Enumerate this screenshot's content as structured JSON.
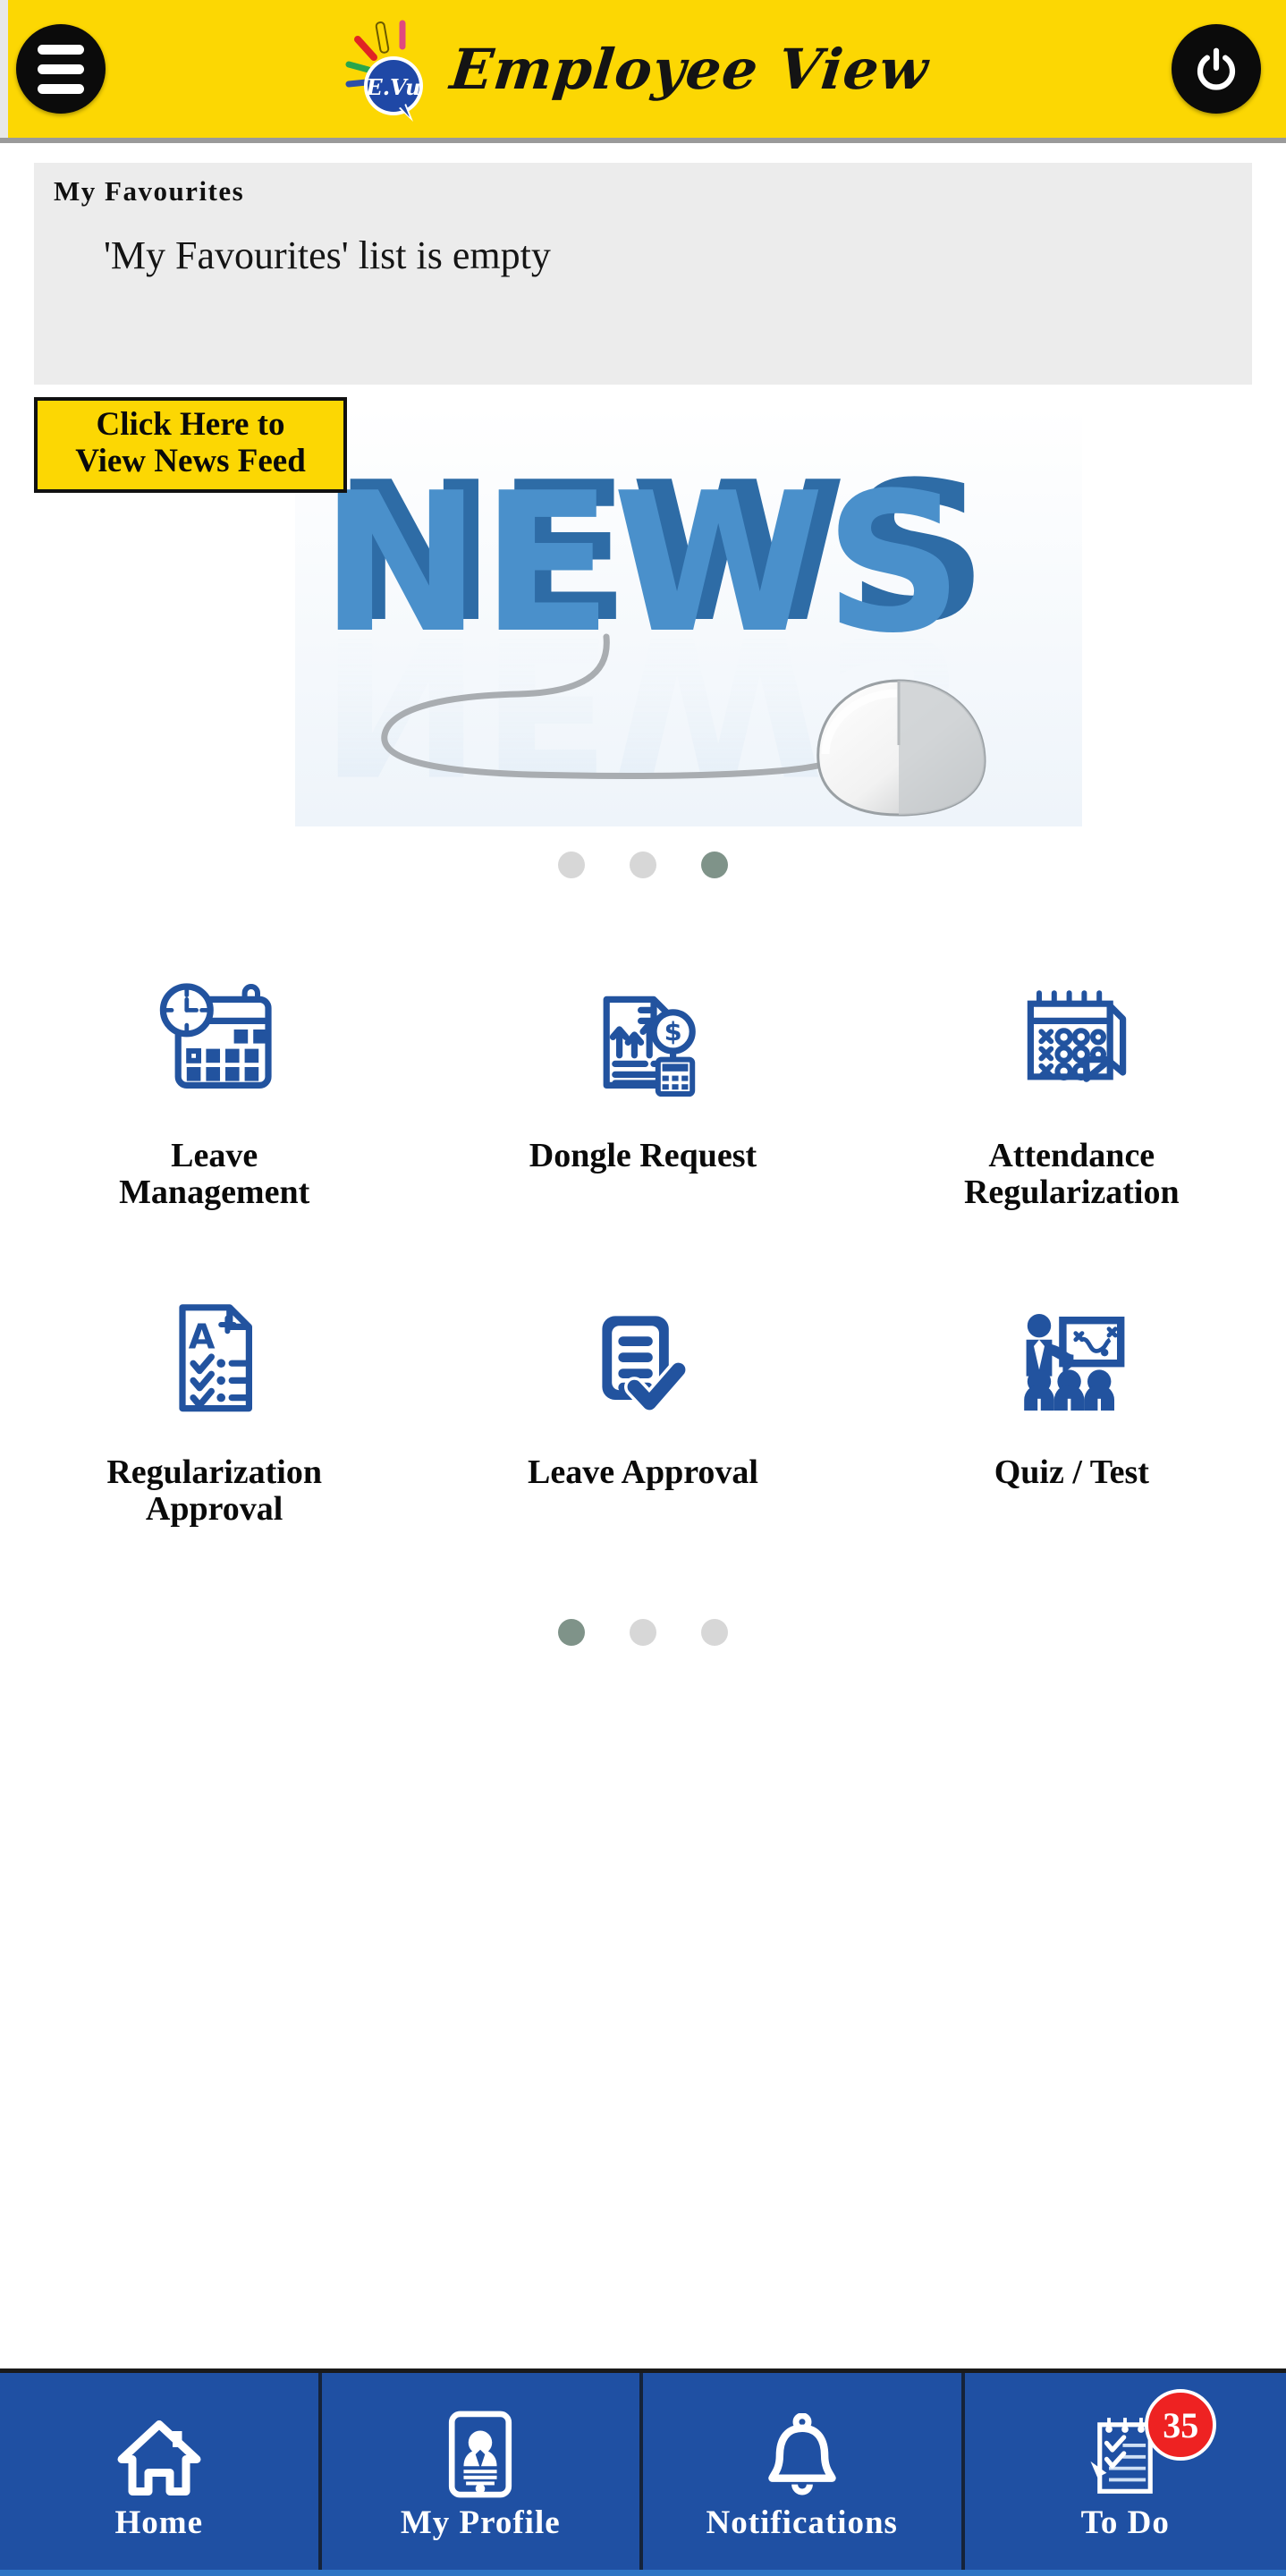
{
  "header": {
    "menu_icon": "hamburger-menu-icon",
    "power_icon": "power-icon",
    "brand_title": "Employee View",
    "logo_text": "E.Vu",
    "background_color": "#FCD703"
  },
  "favourites": {
    "title": "My Favourites",
    "empty_message": "'My Favourites' list is empty"
  },
  "news": {
    "button_line1": "Click Here to",
    "button_line2": "View News Feed",
    "image_word": "NEWS",
    "carousel": {
      "total": 3,
      "active_index": 2
    }
  },
  "apps": {
    "carousel": {
      "total": 3,
      "active_index": 0
    },
    "rows": [
      [
        {
          "label": "Leave Management",
          "icon": "calendar-clock-icon"
        },
        {
          "label": "Dongle Request",
          "icon": "document-dollar-calculator-icon"
        },
        {
          "label": "Attendance Regularization",
          "icon": "wall-calendar-marks-icon"
        }
      ],
      [
        {
          "label": "Regularization Approval",
          "icon": "a-plus-checklist-icon"
        },
        {
          "label": "Leave Approval",
          "icon": "document-check-icon"
        },
        {
          "label": "Quiz / Test",
          "icon": "presentation-training-icon"
        }
      ]
    ]
  },
  "bottom_nav": {
    "accent_color": "#1f50a3",
    "items": [
      {
        "label": "Home",
        "icon": "home-icon",
        "badge": null
      },
      {
        "label": "My Profile",
        "icon": "profile-phone-icon",
        "badge": null
      },
      {
        "label": "Notifications",
        "icon": "bell-icon",
        "badge": null
      },
      {
        "label": "To Do",
        "icon": "todo-notepad-icon",
        "badge": "35"
      }
    ]
  }
}
